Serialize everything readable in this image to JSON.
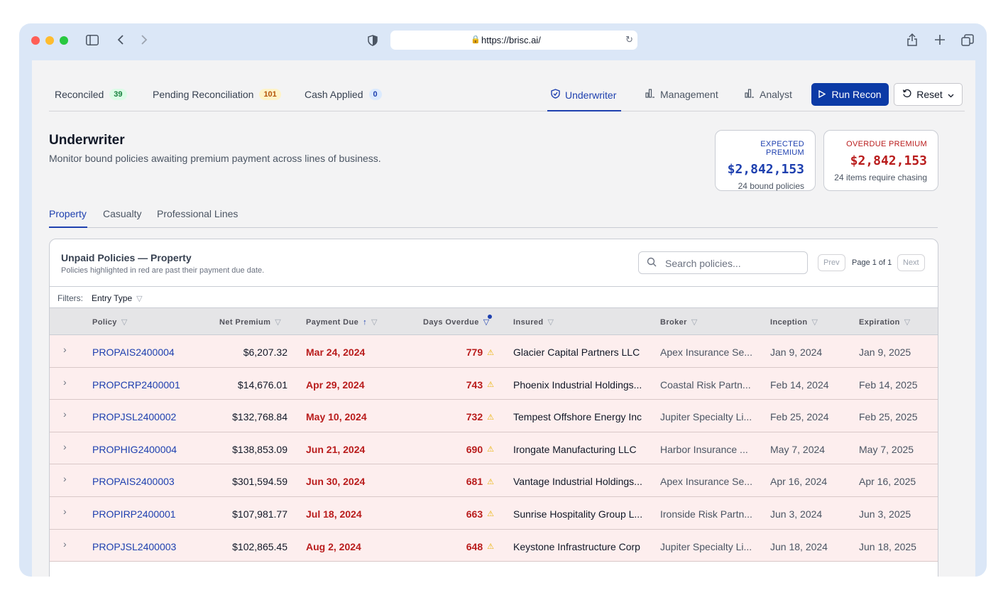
{
  "browser": {
    "url": "https://brisc.ai/"
  },
  "topnav": {
    "tabs": [
      {
        "label": "Reconciled",
        "count": "39"
      },
      {
        "label": "Pending Reconciliation",
        "count": "101"
      },
      {
        "label": "Cash Applied",
        "count": "0"
      }
    ],
    "views": [
      {
        "label": "Underwriter",
        "icon": "shield-check-icon",
        "active": true
      },
      {
        "label": "Management",
        "icon": "bar-chart-icon"
      },
      {
        "label": "Analyst",
        "icon": "bar-chart-icon"
      }
    ],
    "run_label": "Run Recon",
    "reset_label": "Reset"
  },
  "header": {
    "title": "Underwriter",
    "subtitle": "Monitor bound policies awaiting premium payment across lines of business."
  },
  "stats": {
    "expected": {
      "label": "EXPECTED PREMIUM",
      "value": "$2,842,153",
      "foot": "24 bound policies",
      "color": "#1e40af"
    },
    "overdue": {
      "label": "OVERDUE PREMIUM",
      "value": "$2,842,153",
      "foot": "24 items require chasing",
      "color": "#b91c1c"
    }
  },
  "subtabs": [
    "Property",
    "Casualty",
    "Professional Lines"
  ],
  "table": {
    "title": "Unpaid Policies — Property",
    "subtitle": "Policies highlighted in red are past their payment due date.",
    "search_placeholder": "Search policies...",
    "prev_label": "Prev",
    "next_label": "Next",
    "page_text": "Page 1 of 1",
    "filters_label": "Filters:",
    "filter_chip": "Entry Type",
    "columns": [
      "Policy",
      "Net Premium",
      "Payment Due",
      "Days Overdue",
      "Insured",
      "Broker",
      "Inception",
      "Expiration"
    ],
    "rows": [
      {
        "policy": "PROPAIS2400004",
        "net": "$6,207.32",
        "due": "Mar 24, 2024",
        "days": "779",
        "insured": "Glacier Capital Partners LLC",
        "broker": "Apex Insurance Se...",
        "inception": "Jan 9, 2024",
        "expiration": "Jan 9, 2025"
      },
      {
        "policy": "PROPCRP2400001",
        "net": "$14,676.01",
        "due": "Apr 29, 2024",
        "days": "743",
        "insured": "Phoenix Industrial Holdings...",
        "broker": "Coastal Risk Partn...",
        "inception": "Feb 14, 2024",
        "expiration": "Feb 14, 2025"
      },
      {
        "policy": "PROPJSL2400002",
        "net": "$132,768.84",
        "due": "May 10, 2024",
        "days": "732",
        "insured": "Tempest Offshore Energy Inc",
        "broker": "Jupiter Specialty Li...",
        "inception": "Feb 25, 2024",
        "expiration": "Feb 25, 2025"
      },
      {
        "policy": "PROPHIG2400004",
        "net": "$138,853.09",
        "due": "Jun 21, 2024",
        "days": "690",
        "insured": "Irongate Manufacturing LLC",
        "broker": "Harbor Insurance ...",
        "inception": "May 7, 2024",
        "expiration": "May 7, 2025"
      },
      {
        "policy": "PROPAIS2400003",
        "net": "$301,594.59",
        "due": "Jun 30, 2024",
        "days": "681",
        "insured": "Vantage Industrial Holdings...",
        "broker": "Apex Insurance Se...",
        "inception": "Apr 16, 2024",
        "expiration": "Apr 16, 2025"
      },
      {
        "policy": "PROPIRP2400001",
        "net": "$107,981.77",
        "due": "Jul 18, 2024",
        "days": "663",
        "insured": "Sunrise Hospitality Group L...",
        "broker": "Ironside Risk Partn...",
        "inception": "Jun 3, 2024",
        "expiration": "Jun 3, 2025"
      },
      {
        "policy": "PROPJSL2400003",
        "net": "$102,865.45",
        "due": "Aug 2, 2024",
        "days": "648",
        "insured": "Keystone Infrastructure Corp",
        "broker": "Jupiter Specialty Li...",
        "inception": "Jun 18, 2024",
        "expiration": "Jun 18, 2025"
      }
    ]
  }
}
